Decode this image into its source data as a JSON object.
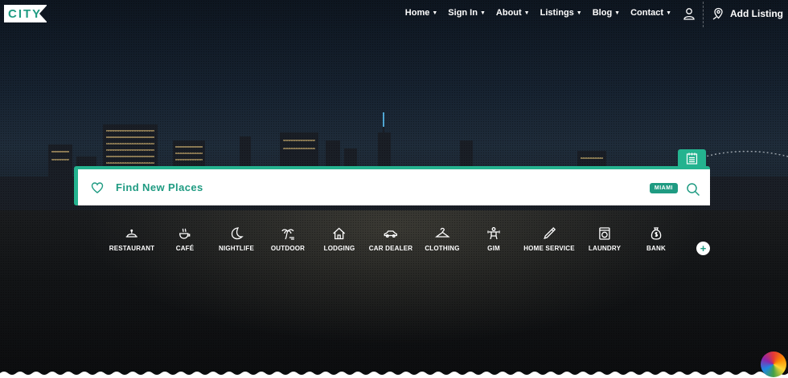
{
  "brand": {
    "logo_text": "CITY",
    "accent_color": "#24b38f"
  },
  "nav": {
    "items": [
      {
        "label": "Home",
        "icon": "caret-down-icon"
      },
      {
        "label": "Sign In",
        "icon": "caret-down-icon"
      },
      {
        "label": "About",
        "icon": "caret-down-icon"
      },
      {
        "label": "Listings",
        "icon": "caret-down-icon"
      },
      {
        "label": "Blog",
        "icon": "caret-down-icon"
      },
      {
        "label": "Contact",
        "icon": "caret-down-icon"
      }
    ],
    "user_icon": "user-icon",
    "add_listing": {
      "label": "Add Listing",
      "icon": "map-pin-icon"
    }
  },
  "search": {
    "placeholder": "Find New Places",
    "location_badge": "MIAMI",
    "left_icon": "heart-icon",
    "button_icon": "search-icon",
    "tab_icon": "calendar-list-icon"
  },
  "categories": [
    {
      "label": "RESTAURANT",
      "icon": "cloche-icon"
    },
    {
      "label": "CAFÉ",
      "icon": "coffee-cup-icon"
    },
    {
      "label": "NIGHTLIFE",
      "icon": "moon-icon"
    },
    {
      "label": "OUTDOOR",
      "icon": "palm-tree-icon"
    },
    {
      "label": "LODGING",
      "icon": "house-icon"
    },
    {
      "label": "CAR DEALER",
      "icon": "car-icon"
    },
    {
      "label": "CLOTHING",
      "icon": "hanger-icon"
    },
    {
      "label": "GIM",
      "icon": "dumbbell-icon"
    },
    {
      "label": "HOME SERVICE",
      "icon": "pen-icon"
    },
    {
      "label": "LAUNDRY",
      "icon": "washing-machine-icon"
    },
    {
      "label": "BANK",
      "icon": "money-bag-icon"
    }
  ],
  "more_button": "+"
}
